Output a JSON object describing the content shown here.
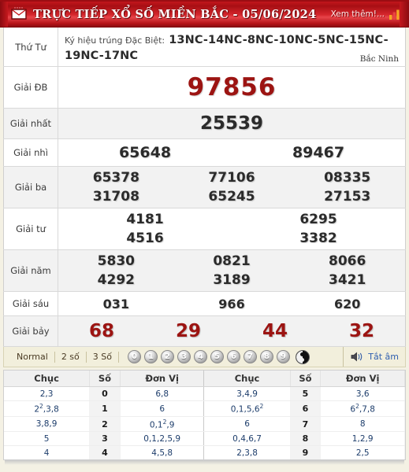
{
  "header": {
    "title": "TRỰC TIẾP XỔ SỐ MIỀN BẮC - 05/06/2024",
    "more_label": "Xem thêm!...",
    "envelope_icon": "envelope-icon",
    "chart_icon": "bar-chart-icon",
    "brand_color": "#a80f14"
  },
  "results": {
    "weekday": "Thứ Tư",
    "symbol_lead": "Ký hiệu trúng Đặc Biệt:",
    "symbol_codes": "13NC-14NC-8NC-10NC-5NC-15NC-19NC-17NC",
    "province": "Bắc Ninh",
    "rows": [
      {
        "label": "Giải ĐB",
        "lines": [
          [
            "97856"
          ]
        ]
      },
      {
        "label": "Giải nhất",
        "lines": [
          [
            "25539"
          ]
        ]
      },
      {
        "label": "Giải nhì",
        "lines": [
          [
            "65648",
            "89467"
          ]
        ]
      },
      {
        "label": "Giải ba",
        "lines": [
          [
            "65378",
            "77106",
            "08335"
          ],
          [
            "31708",
            "65245",
            "27153"
          ]
        ]
      },
      {
        "label": "Giải tư",
        "lines": [
          [
            "4181",
            "6295"
          ],
          [
            "4516",
            "3382"
          ]
        ]
      },
      {
        "label": "Giải năm",
        "lines": [
          [
            "5830",
            "0821",
            "8066"
          ],
          [
            "4292",
            "3189",
            "3421"
          ]
        ]
      },
      {
        "label": "Giải sáu",
        "lines": [
          [
            "031",
            "966",
            "620"
          ]
        ]
      },
      {
        "label": "Giải bảy",
        "lines": [
          [
            "68",
            "29",
            "44",
            "32"
          ]
        ]
      }
    ]
  },
  "toolbar": {
    "modes": [
      "Normal",
      "2 số",
      "3 Số"
    ],
    "digits": [
      "0",
      "1",
      "2",
      "3",
      "4",
      "5",
      "6",
      "7",
      "8",
      "9"
    ],
    "yinyang_icon": "yin-yang-icon",
    "speaker_icon": "speaker-icon",
    "mute_label": "Tắt âm",
    "mute_color": "#2f5fb0"
  },
  "stats": {
    "headers": [
      "Chục",
      "Số",
      "Đơn Vị",
      "Chục",
      "Số",
      "Đơn Vị"
    ],
    "rows": [
      {
        "tens_l": "2,3",
        "num_l": "0",
        "units_l": "6,8",
        "tens_r": "3,4,9",
        "num_r": "5",
        "units_r": "3,6"
      },
      {
        "tens_l": "2²,3,8",
        "num_l": "1",
        "units_l": "6",
        "tens_r": "0,1,5,6²",
        "num_r": "6",
        "units_r": "6²,7,8"
      },
      {
        "tens_l": "3,8,9",
        "num_l": "2",
        "units_l": "0,1²,9",
        "tens_r": "6",
        "num_r": "7",
        "units_r": "8"
      },
      {
        "tens_l": "5",
        "num_l": "3",
        "units_l": "0,1,2,5,9",
        "tens_r": "0,4,6,7",
        "num_r": "8",
        "units_r": "1,2,9"
      },
      {
        "tens_l": "4",
        "num_l": "4",
        "units_l": "4,5,8",
        "tens_r": "2,3,8",
        "num_r": "9",
        "units_r": "2,5"
      }
    ]
  }
}
